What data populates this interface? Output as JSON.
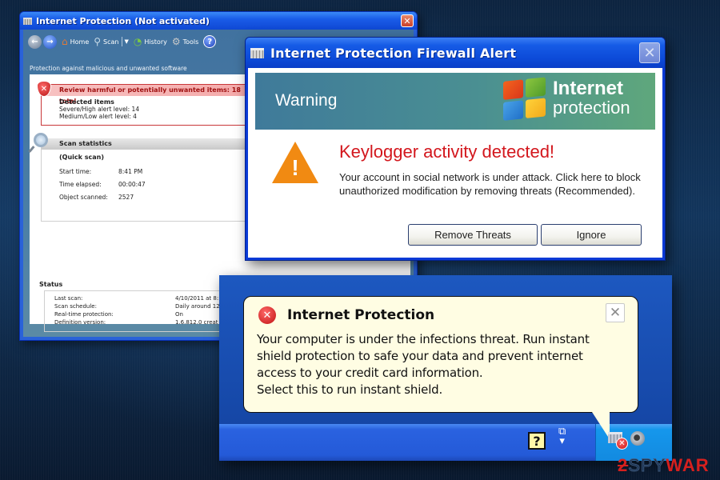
{
  "main_window": {
    "title": "Internet Protection (Not activated)",
    "close_glyph": "✕",
    "toolbar": {
      "back_glyph": "←",
      "forward_glyph": "→",
      "items": [
        {
          "label": "Home",
          "icon": "home-icon",
          "glyph": "⌂"
        },
        {
          "label": "Scan",
          "icon": "magnifier-icon",
          "glyph": "⚲",
          "has_dropdown": true
        },
        {
          "label": "History",
          "icon": "history-icon",
          "glyph": "◔"
        },
        {
          "label": "Tools",
          "icon": "gear-icon",
          "glyph": "⚙"
        }
      ],
      "help_glyph": "?"
    },
    "subtitle": "Protection against malicious and unwanted software",
    "review": {
      "heading": "Review harmful or potentially unwanted items: 18 total",
      "detected_label": "Detected items",
      "severe": "Severe/High alert level: 14",
      "medium": "Medium/Low alert level: 4"
    },
    "scan_stats": {
      "heading": "Scan statistics",
      "mode": "(Quick scan)",
      "rows": [
        {
          "key": "Start time:",
          "value": "8:41 PM"
        },
        {
          "key": "Time elapsed:",
          "value": "00:00:47"
        },
        {
          "key": "Object scanned:",
          "value": "2527"
        }
      ]
    },
    "status": {
      "heading": "Status",
      "rows": [
        {
          "key": "Last scan:",
          "value": "4/10/2011 at 8:"
        },
        {
          "key": "Scan schedule:",
          "value": "Daily around 12"
        },
        {
          "key": "Real-time protection:",
          "value": "On"
        },
        {
          "key": "Definition version:",
          "value": "1.6.812.0 creat"
        }
      ]
    }
  },
  "firewall_alert": {
    "title": "Internet Protection Firewall Alert",
    "close_glyph": "✕",
    "banner_label": "Warning",
    "brand_line1": "Internet",
    "brand_line2": "protection",
    "warning_glyph": "!",
    "headline": "Keylogger activity detected!",
    "message": "Your account in social network is under attack. Click here to block unauthorized modification by removing threats (Recommended).",
    "buttons": {
      "remove": "Remove Threats",
      "ignore": "Ignore"
    },
    "colors": {
      "headline": "#d3171d",
      "warning_triangle": "#f18a12"
    }
  },
  "tray_notification": {
    "title": "Internet Protection",
    "error_glyph": "✕",
    "close_glyph": "✕",
    "message": "Your computer is under the infections threat. Run instant shield protection to safe your data and prevent internet access to your credit card information. Select this to run instant shield.",
    "message_lines": [
      "Your computer is under the infections threat. Run instant",
      "shield protection to safe your data and prevent internet",
      "access to your credit card information.",
      "Select this to run instant shield."
    ],
    "taskbar": {
      "help_glyph": "?",
      "restore_glyph": "⧉",
      "arrow_glyph": "▾",
      "tray_error_glyph": "✕"
    }
  },
  "watermark": {
    "part1": "2",
    "part2": "SPY",
    "part3": "WAR"
  }
}
